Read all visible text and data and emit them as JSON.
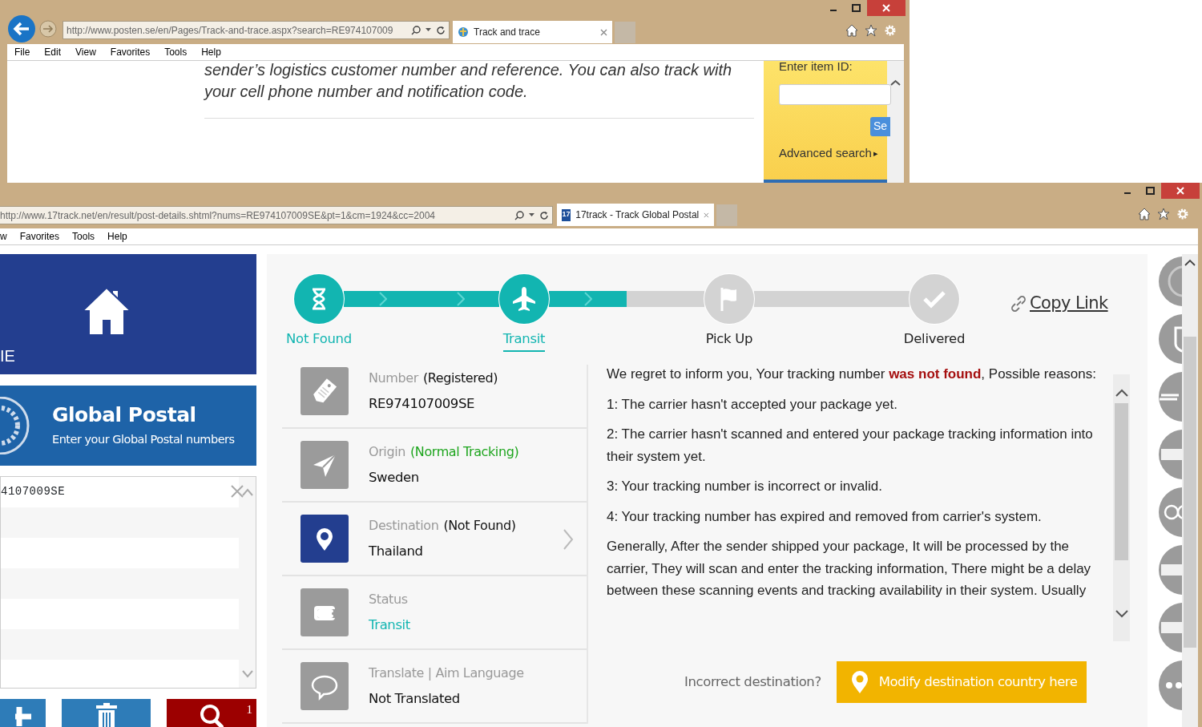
{
  "back_window": {
    "address": "http://www.posten.se/en/Pages/Track-and-trace.aspx?search=RE974107009",
    "tab_title": "Track and trace",
    "menu": [
      "File",
      "Edit",
      "View",
      "Favorites",
      "Tools",
      "Help"
    ],
    "intro_lines": [
      "sender’s logistics customer number and reference. You can also track with",
      "your cell phone number and notification code."
    ],
    "side_panel": {
      "label": "Enter item ID:",
      "button": "Se",
      "advanced": "Advanced search",
      "advanced_arrow": "▸"
    }
  },
  "front_window": {
    "address": "http://www.17track.net/en/result/post-details.shtml?nums=RE974107009SE&pt=1&cm=1924&cc=2004",
    "tab_title": "17track - Track Global Postal",
    "tab_icon_text": "17",
    "menu": [
      "w",
      "Favorites",
      "Tools",
      "Help"
    ],
    "home_tile": {
      "label": "IE"
    },
    "postal_tile": {
      "title": "Global Postal",
      "subtitle": "Enter your Global Postal numbers"
    },
    "number_input": {
      "value": "4107009SE"
    },
    "action_buttons": [
      {
        "kind": "add"
      },
      {
        "kind": "delete"
      },
      {
        "kind": "search",
        "badge": "1"
      }
    ],
    "connectors": [
      {
        "level": 1
      },
      {
        "level": 0.5
      },
      {
        "level": 0
      }
    ],
    "steps": [
      {
        "label": "Not Found",
        "kind": "hourglass",
        "reached": true,
        "selected": false
      },
      {
        "label": "Transit",
        "kind": "plane",
        "reached": true,
        "selected": true
      },
      {
        "label": "Pick Up",
        "kind": "flag",
        "reached": false,
        "selected": false
      },
      {
        "label": "Delivered",
        "kind": "check",
        "reached": false,
        "selected": false
      }
    ],
    "copy_link": "Copy Link",
    "details": [
      {
        "kind": "tag",
        "label": "Number",
        "note": "(Registered)",
        "note_positive": false,
        "value": "RE974107009SE",
        "value_accent": false,
        "highlight": false,
        "expandable": false
      },
      {
        "kind": "send",
        "label": "Origin",
        "note": "(Normal Tracking)",
        "note_positive": true,
        "value": "Sweden",
        "value_accent": false,
        "highlight": false,
        "expandable": false
      },
      {
        "kind": "pin",
        "label": "Destination",
        "note": "(Not Found)",
        "note_positive": false,
        "value": "Thailand",
        "value_accent": false,
        "highlight": true,
        "expandable": true
      },
      {
        "kind": "wallet",
        "label": "Status",
        "value": "Transit",
        "value_accent": true,
        "highlight": false,
        "expandable": false
      },
      {
        "kind": "chat",
        "label": "Translate | Aim Language",
        "value": "Not Translated",
        "value_accent": false,
        "highlight": false,
        "expandable": false
      }
    ],
    "message": [
      "We regret to inform you, Your tracking number **was not found**, Possible reasons:",
      "1: The carrier hasn't accepted your package yet.",
      "2: The carrier hasn't scanned and entered your package tracking information into their system yet.",
      "3: Your tracking number is incorrect or invalid.",
      "4: Your tracking number has expired and removed from carrier's system.",
      "Generally, After the sender shipped your package, It will be processed by the carrier, They will scan and enter the tracking information, There might be a delay between these scanning events and tracking availability in their system. Usually"
    ],
    "destination_prompt": "Incorrect destination?",
    "modify_button": "Modify destination country here",
    "carriers": [
      {
        "kind": "emblem"
      },
      {
        "kind": "shield"
      },
      {
        "kind": "stripes"
      },
      {
        "kind": "bar"
      },
      {
        "kind": "rings"
      },
      {
        "kind": "bar"
      },
      {
        "kind": "bar"
      },
      {
        "kind": "more"
      }
    ]
  }
}
